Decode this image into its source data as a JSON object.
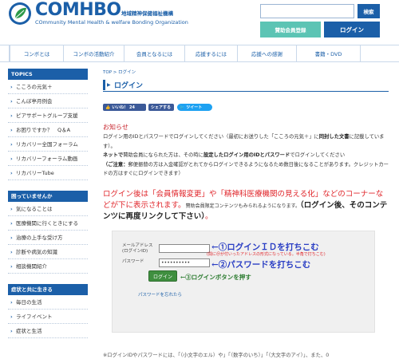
{
  "header": {
    "logo_text": "COMHBO",
    "logo_jp": "地域精神保健福祉機構",
    "logo_sub": "COmmunity Mental Health & welfare Bonding Organization",
    "search_placeholder": "",
    "search_button": "検索",
    "register_button": "賛助会員登録",
    "login_button": "ログイン"
  },
  "nav": {
    "items": [
      "コンボとは",
      "コンボの活動紹介",
      "会員となるには",
      "応援するには",
      "応援への感謝",
      "書籍・DVD"
    ]
  },
  "sidebar": {
    "topics_heading": "TOPICS",
    "topics": [
      "こころの元気＋",
      "こんぼ亭月例会",
      "ピアサポートグループ支援",
      "お困りですか？　Q＆A",
      "リカバリー全国フォーラム",
      "リカバリーフォーラム動画",
      "リカバリーTube"
    ],
    "trouble_heading": "困っていませんか",
    "trouble": [
      "気になることは",
      "医療機関に行くときにする",
      "治療の上手な受け方",
      "診断や病気の知識",
      "相談機関紹介"
    ],
    "life_heading": "症状と共に生きる",
    "life": [
      "毎日の生活",
      "ライフイベント",
      "症状と生活"
    ]
  },
  "main": {
    "breadcrumb": "TOP > ログイン",
    "title": "ログイン",
    "share": {
      "like": "いいね！ 24",
      "share": "シェアする",
      "tweet": "ツイート"
    },
    "notice_heading": "お知らせ",
    "notice_line1_a": "ログイン用のIDとパスワードでログインしてください（最初にお送りした「こころの元気＋」に",
    "notice_line1_b": "同封した文書",
    "notice_line1_c": "に記載しています）。",
    "notice_line2_a": "ネットで",
    "notice_line2_b": "賛助会員になられた方は、その時に",
    "notice_line2_c": "設定したログイン用のIDとパスワード",
    "notice_line2_d": "でログインしてください",
    "notice_line3_a": "（ご注意：",
    "notice_line3_b": "郵便振替の方は入金確認がとれてからログインできるようになるため数日後になることがあります。クレジットカードの方はすぐにログインできます）",
    "red_msg_a": "ログイン後は「会員情報変更」や「精神科医療機関の見える化」などのコーナーなどが下に表示されます。",
    "red_msg_small": "賛助会員限定コンテンツもみられるようになります。",
    "red_msg_b": "（ログイン後、そのコンテンツに再度リンクして下さい）",
    "red_msg_c": "。"
  },
  "form": {
    "email_label_1": "メールアドレス",
    "email_label_2": "(ログインID)",
    "email_value": "",
    "password_label": "パスワード",
    "password_value": "••••••••••",
    "login_button": "ログイン",
    "forgot_link": "パスワードを忘れたら"
  },
  "annotations": {
    "a1": "←①ログインＩＤを打ちこむ",
    "a1_note": "(間に＠が付いったアドレスの形式になっている。半角で打ちこむ)",
    "a2": "←②パスワードを打ちこむ",
    "a3": "←③ログインボタンを押す"
  },
  "footer": {
    "text": "※ログインIDやパスワードには、「（小文字のエル）や」「（数字のいち）」「（大文字のアイ）」、また、0"
  },
  "colors": {
    "brand": "#1b5fa8",
    "accent": "#5cc4b4",
    "alert": "#e0262b",
    "annotation": "#2a3ec4"
  }
}
